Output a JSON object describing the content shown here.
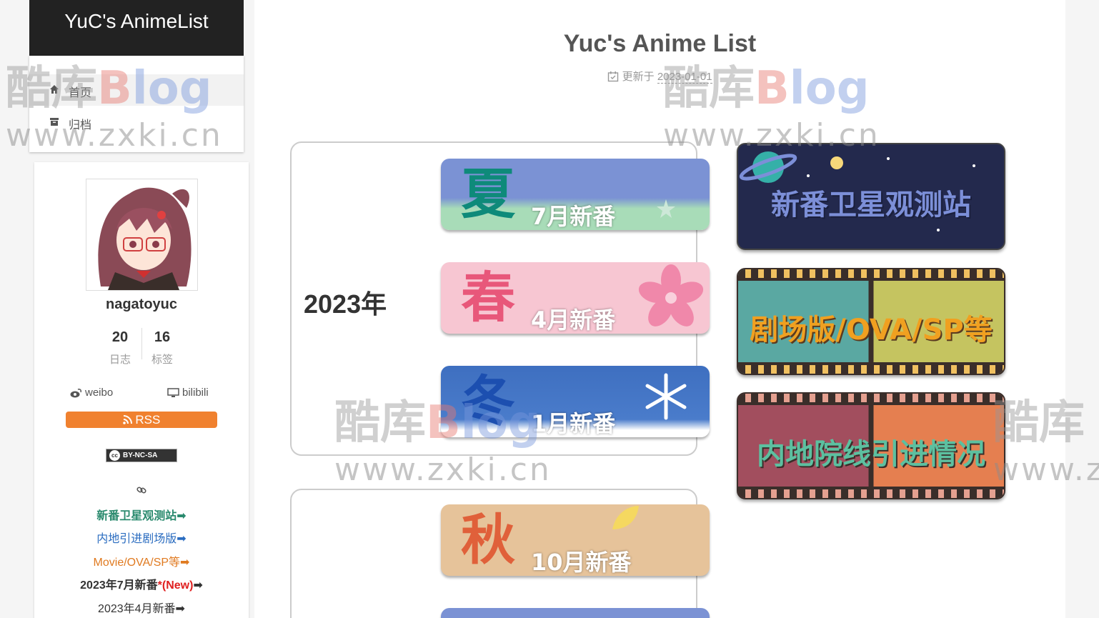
{
  "site": {
    "brand": "YuC's AnimeList"
  },
  "menu": {
    "items": [
      {
        "label": "首页"
      },
      {
        "label": "归档"
      }
    ]
  },
  "profile": {
    "author": "nagatoyuc",
    "stats": [
      {
        "num": "20",
        "label": "日志"
      },
      {
        "num": "16",
        "label": "标签"
      }
    ],
    "links": [
      {
        "label": "weibo"
      },
      {
        "label": "bilibili"
      }
    ],
    "rss": "RSS",
    "license": "BY-NC-SA",
    "license_mark": "cc",
    "blogroll": [
      {
        "label": "新番卫星观测站➡",
        "color": "#2a8a6e"
      },
      {
        "label": "内地引进剧场版➡",
        "color": "#2a6cc0"
      },
      {
        "label": "Movie/OVA/SP等➡",
        "color": "#e07a20"
      },
      {
        "label": "2023年7月新番",
        "new_tag": "*(New)",
        "arrow": "➡",
        "color": "#333",
        "new_color": "#e02020"
      },
      {
        "label": "2023年4月新番➡",
        "color": "#333"
      }
    ]
  },
  "page": {
    "title": "Yuc's Anime List",
    "meta_label": "更新于",
    "meta_date": "2023-01-01"
  },
  "year_2023": {
    "label": "2023年"
  },
  "seasons": [
    {
      "big": "夏",
      "sub": "7月新番",
      "bg": "#7b92d4",
      "bg2": "#a8dcb8",
      "big_color": "#0e8a7a"
    },
    {
      "big": "春",
      "sub": "4月新番",
      "bg": "#f7c6d2",
      "bg2": "#f7c6d2",
      "big_color": "#e8577a"
    },
    {
      "big": "冬",
      "sub": "1月新番",
      "bg": "#3e6fc0",
      "bg2": "#ffffff",
      "big_color": "#1c4fb0"
    },
    {
      "big": "秋",
      "sub": "10月新番",
      "bg": "#e6c39a",
      "bg2": "#e6c39a",
      "big_color": "#e0603a"
    }
  ],
  "banners": [
    {
      "label": "新番卫星观测站",
      "color": "#7c8fd8"
    },
    {
      "label": "剧场版/OVA/SP等",
      "color": "#f0a020"
    },
    {
      "label": "内地院线引进情况",
      "color": "#5cc0a0"
    }
  ],
  "watermark": {
    "cn": "酷库",
    "blog_b": "B",
    "blog_rest": "log",
    "url": "www.zxki.cn"
  }
}
